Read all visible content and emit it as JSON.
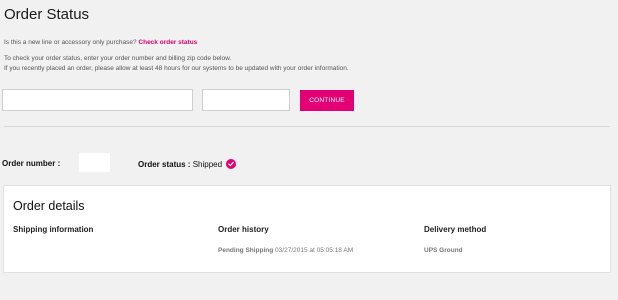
{
  "page": {
    "title": "Order Status"
  },
  "intro": {
    "question": "Is this a new line or accessory only purchase? ",
    "question_link": "Check order status",
    "instruction": "To check your order status, enter your order number and billing zip code below.",
    "note": "If you recently placed an order, please allow at least 48 hours for our systems to be updated with your order information."
  },
  "form": {
    "order_number_value": "",
    "zip_value": "",
    "continue_label": "CONTINUE"
  },
  "summary": {
    "order_number_label": "Order number :",
    "order_number_value": "",
    "order_status_label": "Order status :",
    "order_status_value": " Shipped",
    "status_icon": "check-circle-icon"
  },
  "details": {
    "title": "Order details",
    "shipping_header": "Shipping information",
    "history_header": "Order history",
    "delivery_header": "Delivery method",
    "history": [
      {
        "status": "Pending Shipping",
        "datetime": " 03/27/2015 at 05:05:18 AM"
      }
    ],
    "delivery_method": "UPS Ground"
  },
  "colors": {
    "accent": "#e20074",
    "background": "#f1f1f1",
    "card": "#ffffff"
  }
}
